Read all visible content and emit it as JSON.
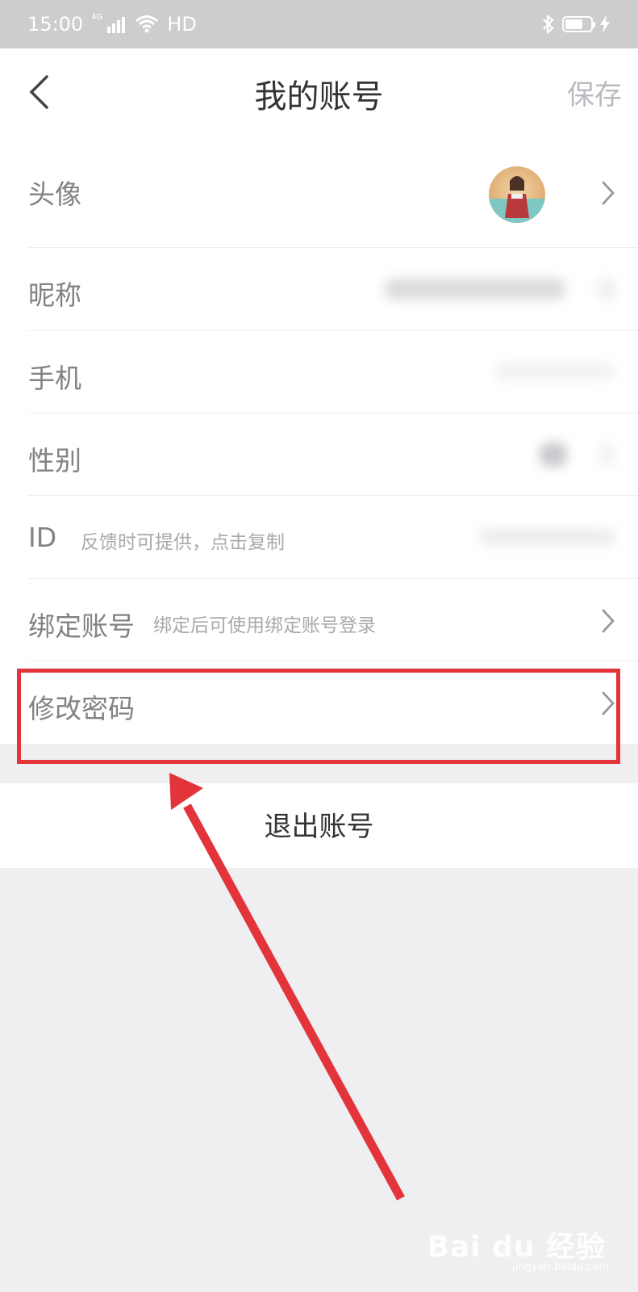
{
  "status_bar": {
    "time": "15:00",
    "network": "4G",
    "hd": "HD"
  },
  "header": {
    "title": "我的账号",
    "save_label": "保存"
  },
  "rows": {
    "avatar_label": "头像",
    "nickname_label": "昵称",
    "phone_label": "手机",
    "gender_label": "性别",
    "id_label": "ID",
    "id_hint": "反馈时可提供，点击复制",
    "bind_label": "绑定账号",
    "bind_hint": "绑定后可使用绑定账号登录",
    "password_label": "修改密码"
  },
  "logout_label": "退出账号",
  "annotation": {
    "highlight_color": "#e3343c"
  },
  "watermark": {
    "brand": "Bai du 经验",
    "url": "jingyan.baidu.com"
  },
  "icons": [
    "back-icon",
    "chevron-right-icon",
    "wifi-icon",
    "signal-icon",
    "bluetooth-icon",
    "battery-icon",
    "charging-icon"
  ]
}
